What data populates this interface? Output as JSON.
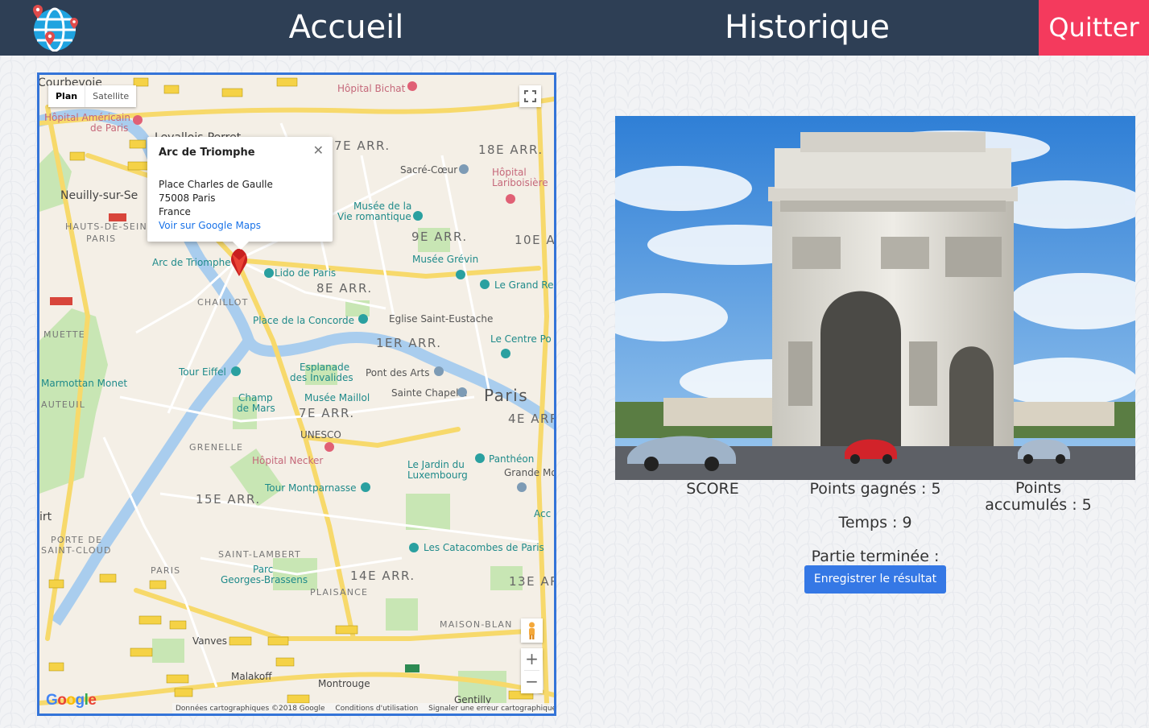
{
  "nav": {
    "home_label": "Accueil",
    "history_label": "Historique",
    "quit_label": "Quitter",
    "logo_icon": "globe-pin-icon",
    "colors": {
      "bar": "#2e3f55",
      "quit": "#f43a5d"
    }
  },
  "map": {
    "type_plan": "Plan",
    "type_satellite": "Satellite",
    "popup": {
      "title": "Arc de Triomphe",
      "address_1": "Place Charles de Gaulle",
      "address_2": "75008 Paris",
      "address_3": "France",
      "link": "Voir sur Google Maps"
    },
    "labels": {
      "courbevoie": "Courbevoie",
      "levallois": "Levallois-Perret",
      "neuilly": "Neuilly-sur-Se",
      "hauts_de_seine": "HAUTS-DE-SEINE",
      "paris_small": "PARIS",
      "arr17": "17E ARR.",
      "arr18": "18E ARR.",
      "arr9": "9E ARR.",
      "arr10": "10E A",
      "arr8": "8E ARR.",
      "arr1": "1ER ARR.",
      "arr7": "7E ARR.",
      "arr4": "4E ARR",
      "arr15": "15E ARR.",
      "arr14": "14E ARR.",
      "arr13": "13E AR",
      "paris": "Paris",
      "chaillot": "CHAILLOT",
      "muette": "MUETTE",
      "auteuil": "AUTEUIL",
      "grenelle": "GRENELLE",
      "saint_lambert": "SAINT-LAMBERT",
      "plaisance": "PLAISANCE",
      "maison_blanche": "MAISON-BLAN",
      "porte_saint_cloud_1": "PORTE DE",
      "porte_saint_cloud_2": "SAINT-CLOUD",
      "vanves": "Vanves",
      "malakoff": "Malakoff",
      "montrouge": "Montrouge",
      "gentilly": "Gentilly",
      "hopital_bichat": "Hôpital Bichat",
      "hopital_americain_1": "Hôpital Américain",
      "hopital_americain_2": "de Paris",
      "sacre_coeur": "Sacré-Cœur",
      "lariboisiere_1": "Hôpital",
      "lariboisiere_2": "Lariboisière",
      "musee_vie_1": "Musée de la",
      "musee_vie_2": "Vie romantique",
      "arc": "Arc de Triomphe",
      "lido": "Lido de Paris",
      "grevin": "Musée Grévin",
      "grand_rex": "Le Grand Re",
      "concorde": "Place de la Concorde",
      "saint_eustache": "Eglise Saint-Eustache",
      "centre_pompidou": "Le Centre Po",
      "tour_eiffel": "Tour Eiffel",
      "marmottan": "Marmottan Monet",
      "esplanade_1": "Esplanade",
      "esplanade_2": "des Invalides",
      "pont_arts": "Pont des Arts",
      "champ_1": "Champ",
      "champ_2": "de Mars",
      "maillol": "Musée Maillol",
      "sainte_chapelle": "Sainte Chapelle",
      "unesco": "UNESCO",
      "necker": "Hôpital Necker",
      "luxembourg_1": "Le Jardin du",
      "luxembourg_2": "Luxembourg",
      "pantheon": "Panthéon",
      "grande_mosquee": "Grande Mo",
      "montparnasse": "Tour Montparnasse",
      "catacombes": "Les Catacombes de Paris",
      "brassens_1": "Parc",
      "brassens_2": "Georges-Brassens",
      "acc": "Acc",
      "irt": "irt",
      "paris_14": "PARIS"
    },
    "attribution": {
      "data": "Données cartographiques ©2018 Google",
      "terms": "Conditions d'utilisation",
      "report": "Signaler une erreur cartographique"
    }
  },
  "result": {
    "score_label": "SCORE",
    "points_gained": "Points gagnés : 5",
    "points_accum_1": "Points",
    "points_accum_2": "accumulés : 5",
    "time": "Temps : 9",
    "game_over": "Partie terminée :",
    "save_button": "Enregistrer le résultat"
  }
}
